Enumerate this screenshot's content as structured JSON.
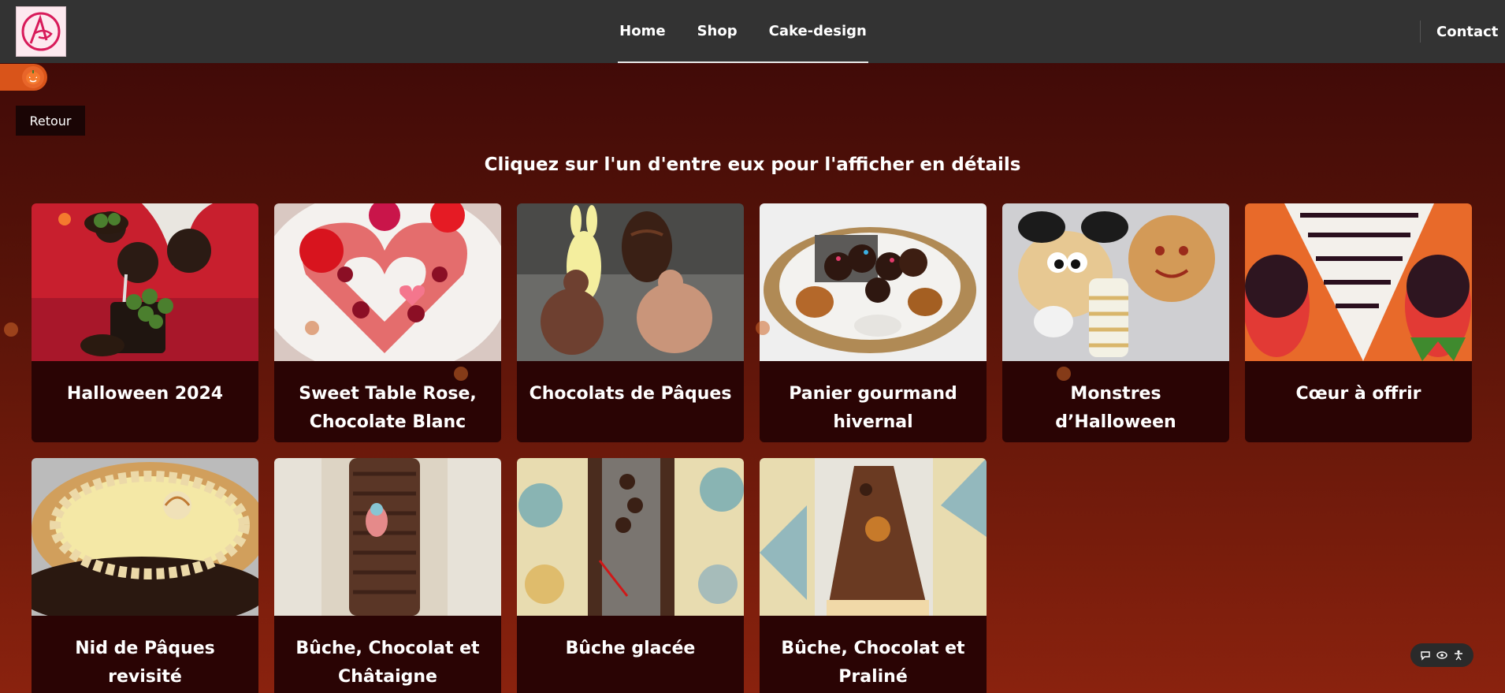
{
  "header": {
    "logo_alt": "logo",
    "nav": [
      {
        "label": "Home"
      },
      {
        "label": "Shop"
      },
      {
        "label": "Cake-design"
      }
    ],
    "contact_label": "Contact"
  },
  "theme_toggle": {
    "icon": "pumpkin-icon"
  },
  "back_button_label": "Retour",
  "heading": "Cliquez sur l'un d'entre eux pour l'afficher en détails",
  "gallery": [
    {
      "title": "Halloween 2024",
      "photo": "halloween-cake-pops"
    },
    {
      "title": "Sweet Table Rose, Chocolate Blanc",
      "photo": "heart-cake"
    },
    {
      "title": "Chocolats de Pâques",
      "photo": "easter-chocolates"
    },
    {
      "title": "Panier gourmand hivernal",
      "photo": "winter-basket"
    },
    {
      "title": "Monstres d’Halloween",
      "photo": "halloween-monsters"
    },
    {
      "title": "Cœur à offrir",
      "photo": "heart-dessert"
    },
    {
      "title": "Nid de Pâques revisité",
      "photo": "easter-nest-cake"
    },
    {
      "title": "Bûche, Chocolat et Châtaigne",
      "photo": "yule-log-chestnut"
    },
    {
      "title": "Bûche glacée",
      "photo": "iced-yule-log"
    },
    {
      "title": "Bûche, Chocolat et Praliné",
      "photo": "yule-log-praline"
    }
  ],
  "accessibility_toolbar": {
    "icons": [
      "chat-icon",
      "eye-icon",
      "accessibility-icon"
    ]
  },
  "colors": {
    "header_bg": "#333333",
    "card_bg": "#2a0404",
    "toggle": "#d9541a"
  }
}
